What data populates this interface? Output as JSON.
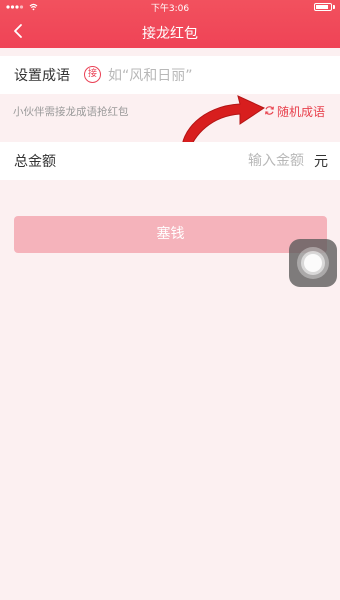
{
  "status_bar": {
    "time": "下午3:06",
    "icons": [
      "signal-icon",
      "wifi-icon",
      "battery-icon"
    ]
  },
  "nav": {
    "title": "接龙红包",
    "back_icon": "chevron-left-icon"
  },
  "idiom_row": {
    "label": "设置成语",
    "badge": "接",
    "placeholder": "如“风和日丽”"
  },
  "hint": "小伙伴需接龙成语抢红包",
  "random_idiom": {
    "icon": "refresh-icon",
    "label": "随机成语"
  },
  "amount_row": {
    "label": "总金额",
    "placeholder": "输入金额",
    "unit": "元"
  },
  "submit_label": "塞钱",
  "colors": {
    "brand_red": "#ef4356",
    "disabled_button": "#f5b3bb",
    "page_bg": "#fcf0f1",
    "annotation_arrow": "#d81e1e"
  }
}
